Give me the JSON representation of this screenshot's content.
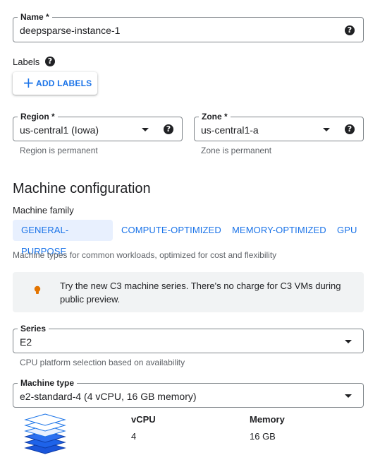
{
  "name_field": {
    "label": "Name *",
    "value": "deepsparse-instance-1"
  },
  "labels": {
    "heading": "Labels",
    "add_button": "ADD LABELS"
  },
  "region": {
    "label": "Region *",
    "value": "us-central1 (Iowa)",
    "hint": "Region is permanent"
  },
  "zone": {
    "label": "Zone *",
    "value": "us-central1-a",
    "hint": "Zone is permanent"
  },
  "machine_config": {
    "title": "Machine configuration",
    "family_label": "Machine family",
    "tabs": [
      "GENERAL-PURPOSE",
      "COMPUTE-OPTIMIZED",
      "MEMORY-OPTIMIZED",
      "GPU"
    ],
    "active_tab": "GENERAL-PURPOSE",
    "family_description": "Machine types for common workloads, optimized for cost and flexibility"
  },
  "banner": {
    "icon": "lightbulb-icon",
    "text": "Try the new C3 machine series. There's no charge for C3 VMs during public preview."
  },
  "series": {
    "label": "Series",
    "value": "E2",
    "hint": "CPU platform selection based on availability"
  },
  "machine_type": {
    "label": "Machine type",
    "value": "e2-standard-4 (4 vCPU, 16 GB memory)"
  },
  "specs": {
    "vcpu_label": "vCPU",
    "vcpu_value": "4",
    "memory_label": "Memory",
    "memory_value": "16 GB"
  },
  "colors": {
    "accent": "#1a73e8",
    "tab_active_bg": "#e8f0fe",
    "banner_bg": "#f1f3f4",
    "bulb": "#e37400"
  }
}
